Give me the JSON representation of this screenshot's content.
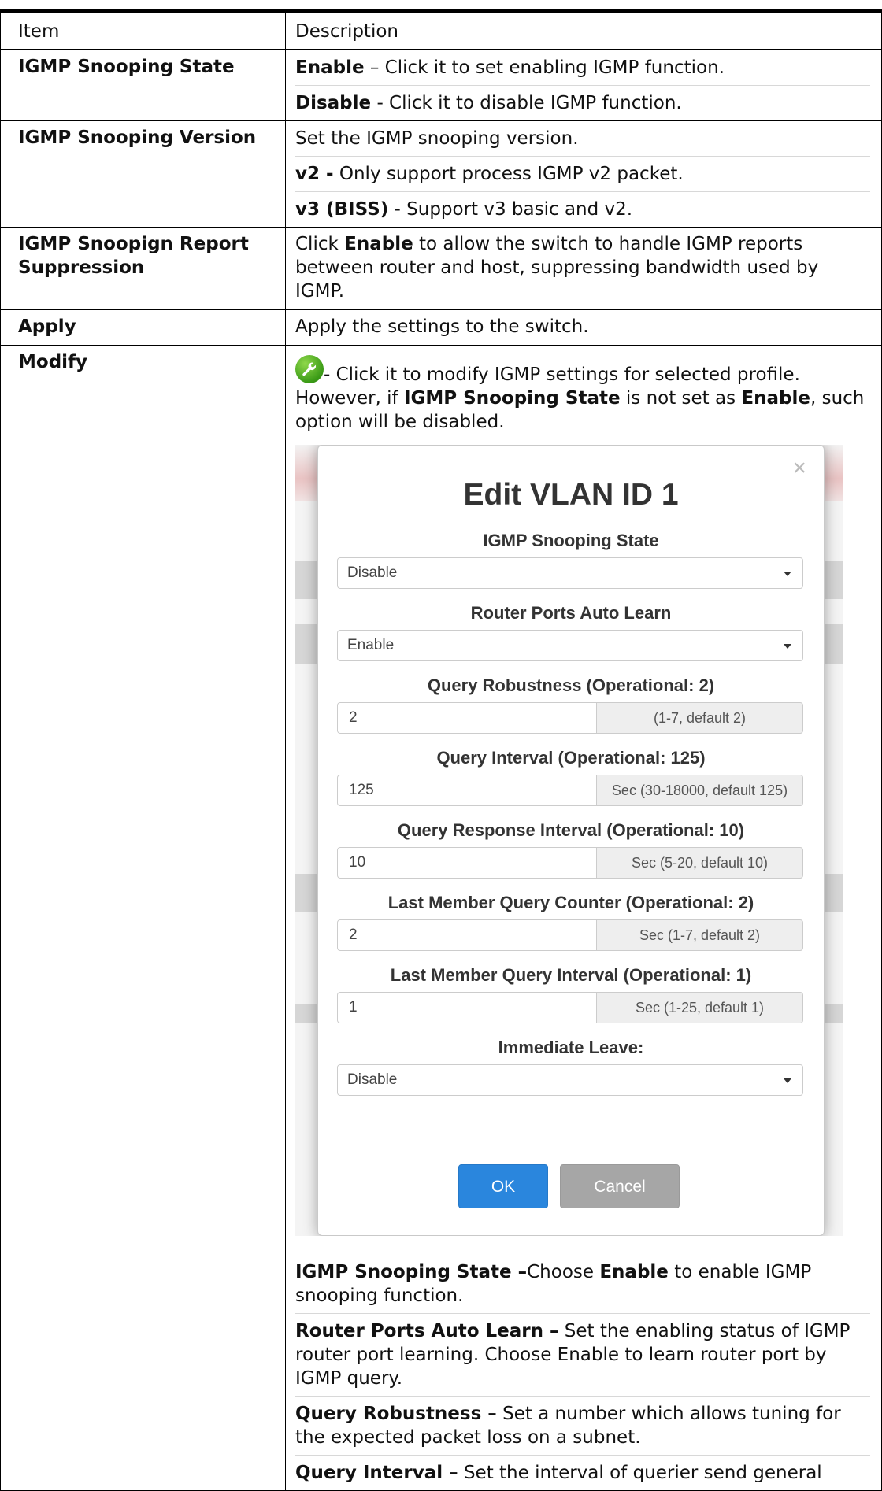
{
  "header": {
    "item": "Item",
    "description": "Description"
  },
  "rows": {
    "state": {
      "item": "IGMP Snooping State",
      "lines": [
        {
          "b": "Enable",
          "t": " – Click it to set enabling IGMP function."
        },
        {
          "b": "Disable",
          "t": " - Click it to disable IGMP function."
        }
      ]
    },
    "version": {
      "item": "IGMP Snooping Version",
      "l1": "Set the IGMP snooping version.",
      "lines": [
        {
          "b": "v2 -",
          "t": " Only support process IGMP v2 packet."
        },
        {
          "b": "v3 (BISS)",
          "t": " - Support v3 basic and v2."
        }
      ]
    },
    "report": {
      "item": "IGMP Snoopign Report Suppression",
      "pre": "Click ",
      "b": "Enable",
      "post": " to allow the switch to handle IGMP reports between router and host, suppressing bandwidth used by IGMP."
    },
    "apply": {
      "item": "Apply",
      "text": "Apply the settings to the switch."
    },
    "modify": {
      "item": "Modify",
      "intro1": "- Click it to modify IGMP settings for selected profile.",
      "intro2_pre": "However, if ",
      "intro2_b1": "IGMP Snooping State",
      "intro2_mid": " is not set as ",
      "intro2_b2": "Enable",
      "intro2_post": ", such option will be disabled.",
      "notes": [
        {
          "b": "IGMP Snooping State –",
          "t": "Choose ",
          "b2": "Enable",
          "t2": " to enable IGMP snooping function."
        },
        {
          "b": "Router Ports Auto Learn –",
          "t": " Set the enabling status of IGMP router port learning. Choose Enable to learn router port by IGMP query.",
          "b2": "",
          "t2": ""
        },
        {
          "b": "Query Robustness –",
          "t": " Set a number which allows tuning for the expected packet loss on a subnet.",
          "b2": "",
          "t2": ""
        },
        {
          "b": "Query Interval –",
          "t": " Set the interval of querier send general",
          "b2": "",
          "t2": ""
        }
      ]
    }
  },
  "dialog": {
    "title": "Edit VLAN ID 1",
    "close": "×",
    "fields": {
      "state": {
        "label": "IGMP Snooping State",
        "value": "Disable"
      },
      "auto_learn": {
        "label": "Router Ports Auto Learn",
        "value": "Enable"
      },
      "robustness": {
        "label": "Query Robustness (Operational: 2)",
        "value": "2",
        "hint": "(1-7, default 2)"
      },
      "interval": {
        "label": "Query Interval (Operational: 125)",
        "value": "125",
        "hint": "Sec (30-18000, default 125)"
      },
      "response": {
        "label": "Query Response Interval (Operational: 10)",
        "value": "10",
        "hint": "Sec (5-20, default 10)"
      },
      "lm_counter": {
        "label": "Last Member Query Counter (Operational: 2)",
        "value": "2",
        "hint": "Sec (1-7, default 2)"
      },
      "lm_interval": {
        "label": "Last Member Query Interval (Operational: 1)",
        "value": "1",
        "hint": "Sec (1-25, default 1)"
      },
      "leave": {
        "label": "Immediate Leave:",
        "value": "Disable"
      }
    },
    "ok": "OK",
    "cancel": "Cancel"
  },
  "colors": {
    "ok": "#2a86dd",
    "cancel": "#a6a6a6",
    "wrench": "#3a9a16"
  }
}
